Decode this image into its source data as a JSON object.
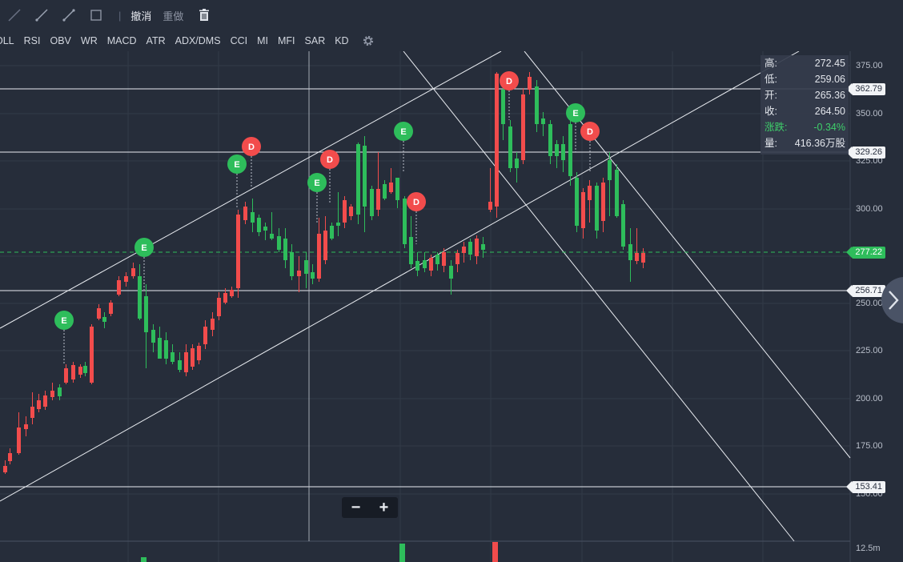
{
  "toolbar": {
    "undo_label": "撤消",
    "redo_label": "重做",
    "separator": "|"
  },
  "indicators": [
    "OLL",
    "RSI",
    "OBV",
    "WR",
    "MACD",
    "ATR",
    "ADX/DMS",
    "CCI",
    "MI",
    "MFI",
    "SAR",
    "KD"
  ],
  "info_panel": {
    "high_label": "高:",
    "high": "272.45",
    "low_label": "低:",
    "low": "259.06",
    "open_label": "开:",
    "open": "265.36",
    "close_label": "收:",
    "close": "264.50",
    "change_label": "涨跌:",
    "change": "-0.34%",
    "volume_label": "量:",
    "volume": "416.36万股"
  },
  "price_tags": {
    "line1": "362.79",
    "line2": "329.26",
    "current": "277.22",
    "line3": "256.71",
    "line4": "153.41"
  },
  "y_axis": [
    "375.00",
    "350.00",
    "325.00",
    "300.00",
    "250.00",
    "225.00",
    "200.00",
    "175.00",
    "150.00"
  ],
  "volume_axis_label": "12.5m",
  "zoom": {
    "minus": "−",
    "plus": "+"
  },
  "colors": {
    "up": "#2ebd5b",
    "down": "#f24c4c",
    "background": "#262d3a"
  },
  "markers": [
    {
      "type": "E"
    },
    {
      "type": "E"
    },
    {
      "type": "E"
    },
    {
      "type": "D"
    },
    {
      "type": "E"
    },
    {
      "type": "D"
    },
    {
      "type": "E"
    },
    {
      "type": "D"
    },
    {
      "type": "D"
    },
    {
      "type": "E"
    },
    {
      "type": "D"
    }
  ]
}
